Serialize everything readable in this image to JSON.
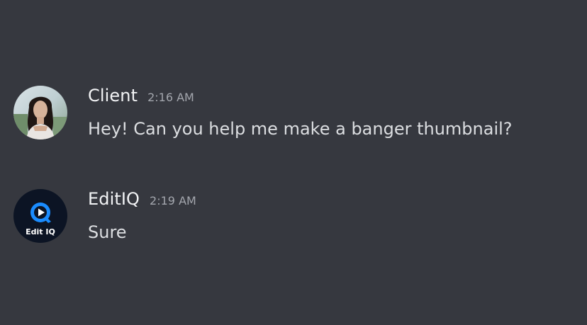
{
  "messages": [
    {
      "author": "Client",
      "timestamp": "2:16 AM",
      "text": "Hey! Can you help me make a banger thumbnail?",
      "avatar_icon": "profile-photo-icon"
    },
    {
      "author": "EditIQ",
      "timestamp": "2:19 AM",
      "text": "Sure",
      "avatar_icon": "editiq-logo-icon",
      "avatar_logo_text": "Edit IQ"
    }
  ],
  "colors": {
    "background": "#36383f",
    "username": "#f2f3f5",
    "timestamp": "#a3a6ad",
    "message_text": "#dcdee1",
    "editiq_logo_bg": "#0c1424",
    "editiq_logo_accent": "#1a8cff"
  }
}
